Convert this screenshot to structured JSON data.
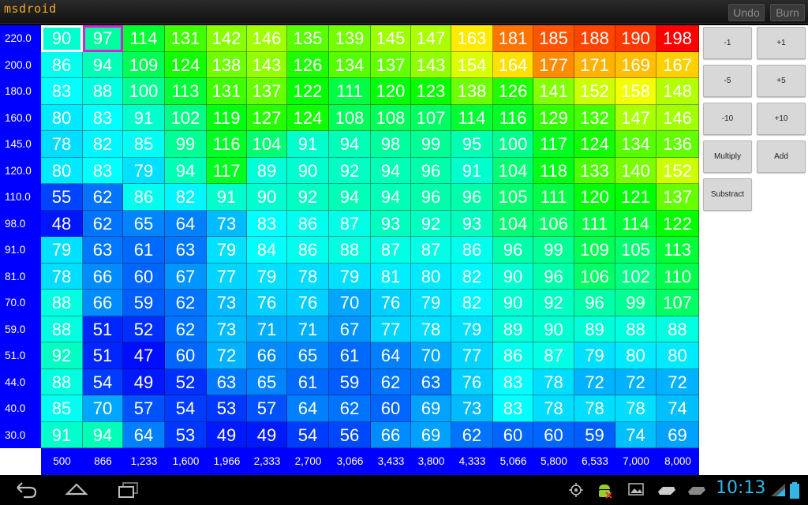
{
  "app": {
    "title": "msdroid",
    "undo_label": "Undo",
    "burn_label": "Burn"
  },
  "map": {
    "row_labels": [
      "220.0",
      "200.0",
      "180.0",
      "160.0",
      "145.0",
      "120.0",
      "110.0",
      "98.0",
      "91.0",
      "81.0",
      "70.0",
      "59.0",
      "51.0",
      "44.0",
      "40.0",
      "30.0"
    ],
    "col_labels": [
      "500",
      "866",
      "1,233",
      "1,600",
      "1,966",
      "2,333",
      "2,700",
      "3,066",
      "3,433",
      "3,800",
      "4,333",
      "5,066",
      "5,800",
      "6,533",
      "7,000",
      "8,000"
    ],
    "rows": [
      [
        90,
        97,
        114,
        131,
        142,
        146,
        135,
        139,
        145,
        147,
        163,
        181,
        185,
        188,
        190,
        198
      ],
      [
        86,
        94,
        109,
        124,
        138,
        143,
        126,
        134,
        137,
        143,
        154,
        164,
        177,
        171,
        169,
        167
      ],
      [
        83,
        88,
        100,
        113,
        131,
        137,
        122,
        111,
        120,
        123,
        138,
        126,
        141,
        152,
        158,
        148
      ],
      [
        80,
        83,
        91,
        102,
        119,
        127,
        124,
        108,
        108,
        107,
        114,
        116,
        129,
        132,
        147,
        146
      ],
      [
        78,
        82,
        85,
        99,
        116,
        104,
        91,
        94,
        98,
        99,
        95,
        100,
        117,
        124,
        134,
        136
      ],
      [
        80,
        83,
        79,
        94,
        117,
        89,
        90,
        92,
        94,
        96,
        91,
        104,
        118,
        133,
        140,
        152
      ],
      [
        55,
        62,
        86,
        82,
        91,
        90,
        92,
        94,
        94,
        96,
        96,
        105,
        111,
        120,
        121,
        137
      ],
      [
        48,
        62,
        65,
        64,
        73,
        83,
        86,
        87,
        93,
        92,
        93,
        104,
        106,
        111,
        114,
        122
      ],
      [
        79,
        63,
        61,
        63,
        79,
        84,
        86,
        88,
        87,
        87,
        86,
        96,
        99,
        109,
        105,
        113
      ],
      [
        78,
        66,
        60,
        67,
        77,
        79,
        78,
        79,
        81,
        80,
        82,
        90,
        96,
        106,
        102,
        110
      ],
      [
        88,
        66,
        59,
        62,
        73,
        76,
        76,
        70,
        76,
        79,
        82,
        90,
        92,
        96,
        99,
        107
      ],
      [
        88,
        51,
        52,
        62,
        73,
        71,
        71,
        67,
        77,
        78,
        79,
        89,
        90,
        89,
        88,
        88
      ],
      [
        92,
        51,
        47,
        60,
        72,
        66,
        65,
        61,
        64,
        70,
        77,
        86,
        87,
        79,
        80,
        80
      ],
      [
        88,
        54,
        49,
        52,
        63,
        65,
        61,
        59,
        62,
        63,
        76,
        83,
        78,
        72,
        72,
        72
      ],
      [
        85,
        70,
        57,
        54,
        53,
        57,
        64,
        62,
        60,
        69,
        73,
        83,
        78,
        78,
        78,
        74
      ],
      [
        91,
        94,
        64,
        53,
        49,
        49,
        54,
        56,
        66,
        69,
        62,
        60,
        60,
        59,
        74,
        69
      ]
    ],
    "color_scale": {
      "min": 45,
      "max": 198,
      "low_color": "#0000ff",
      "high_color": "#ff0000"
    }
  },
  "panel": {
    "buttons": [
      {
        "name": "minus-1-button",
        "label": "-1"
      },
      {
        "name": "plus-1-button",
        "label": "+1"
      },
      {
        "name": "minus-5-button",
        "label": "-5"
      },
      {
        "name": "plus-5-button",
        "label": "+5"
      },
      {
        "name": "minus-10-button",
        "label": "-10"
      },
      {
        "name": "plus-10-button",
        "label": "+10"
      },
      {
        "name": "multiply-button",
        "label": "Multiply"
      },
      {
        "name": "add-button",
        "label": "Add"
      },
      {
        "name": "substract-button",
        "label": "Substract"
      }
    ]
  },
  "system": {
    "time": "10:13",
    "nav_icons": [
      "back-icon",
      "home-icon",
      "recent-apps-icon"
    ],
    "status_icons": [
      "gps-icon",
      "android-debug-icon",
      "gallery-icon",
      "usb-icon",
      "usb-storage-icon",
      "wifi-icon",
      "battery-icon"
    ]
  }
}
